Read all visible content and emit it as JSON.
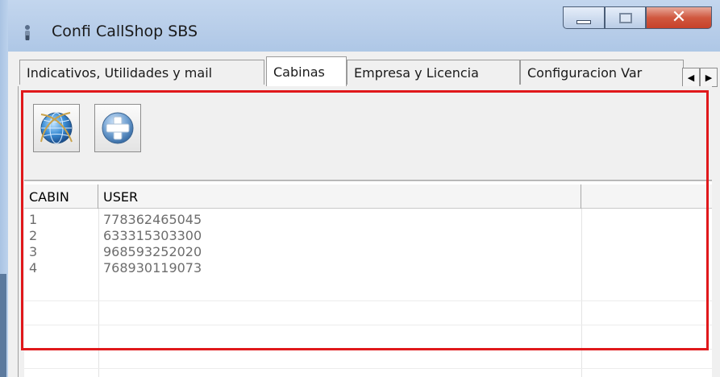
{
  "window": {
    "title": "Confi CallShop SBS",
    "colors": {
      "accent_highlight": "#e0181b",
      "close_button": "#c7412a"
    }
  },
  "tabs": [
    {
      "label": "Indicativos, Utilidades y mail",
      "active": false
    },
    {
      "label": "Cabinas",
      "active": true
    },
    {
      "label": "Empresa y Licencia",
      "active": false
    },
    {
      "label": "Configuracion Var",
      "active": false
    }
  ],
  "toolbar": {
    "buttons": [
      {
        "icon": "globe-icon"
      },
      {
        "icon": "add-plus-icon"
      }
    ]
  },
  "grid": {
    "columns": [
      "CABIN",
      "USER",
      ""
    ],
    "rows": [
      [
        "1",
        "778362465045",
        ""
      ],
      [
        "2",
        "633315303300",
        ""
      ],
      [
        "3",
        "968593252020",
        ""
      ],
      [
        "4",
        "768930119073",
        ""
      ]
    ]
  }
}
